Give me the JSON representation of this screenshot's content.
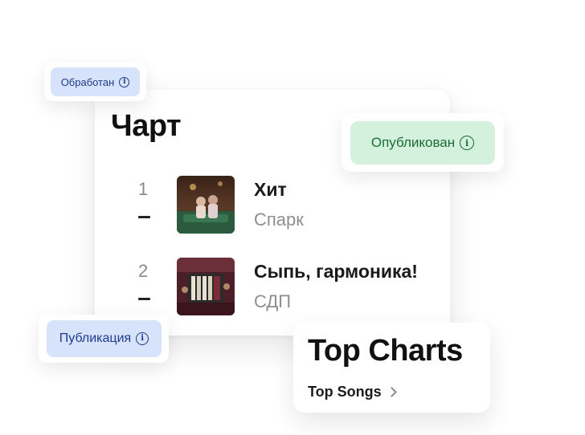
{
  "chart_card": {
    "title": "Чарт",
    "tracks": [
      {
        "rank": "1",
        "trend": "–",
        "title": "Хит",
        "artist": "Спарк",
        "cover_icon": "album-cover-couple-image"
      },
      {
        "rank": "2",
        "trend": "–",
        "title": "Сыпь, гармоника!",
        "artist": "СДП",
        "cover_icon": "album-cover-accordion-image"
      }
    ]
  },
  "badges": {
    "processed": {
      "label": "Обработан",
      "icon": "info-icon",
      "bg": "#d7e3fb",
      "fg": "#1f3a8a"
    },
    "published": {
      "label": "Опубликован",
      "icon": "info-icon",
      "bg": "#d3f1dd",
      "fg": "#1c6b37"
    },
    "publication": {
      "label": "Публикация",
      "icon": "info-icon",
      "bg": "#d7e3fb",
      "fg": "#1f3a8a"
    }
  },
  "top_charts": {
    "title": "Top Charts",
    "link_label": "Top Songs",
    "link_icon": "chevron-right-icon"
  }
}
